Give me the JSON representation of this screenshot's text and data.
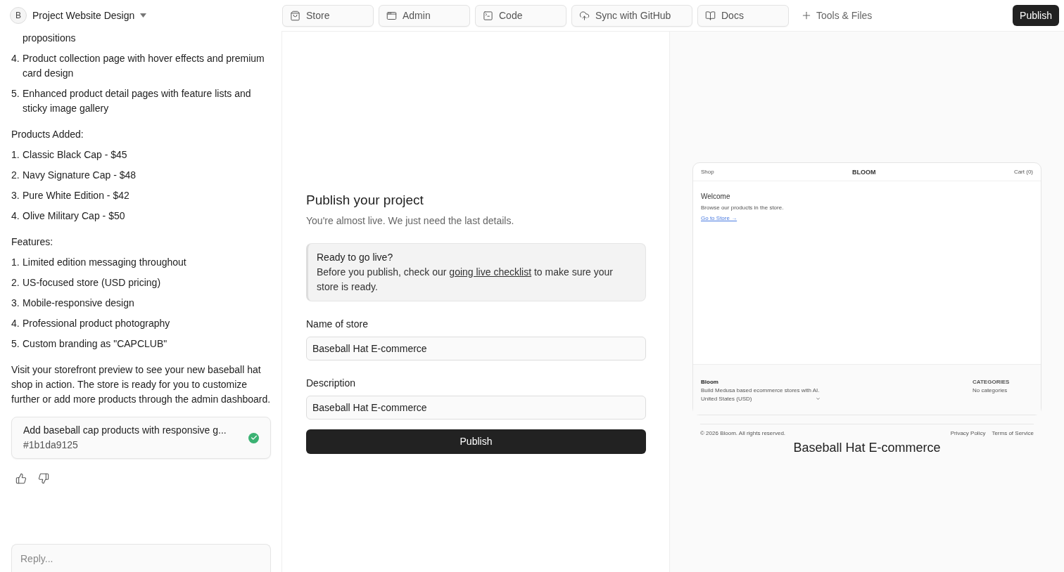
{
  "project": {
    "avatar": "B",
    "title": "Project Website Design"
  },
  "tabs": [
    {
      "label": "Store"
    },
    {
      "label": "Admin"
    },
    {
      "label": "Code"
    },
    {
      "label": "Sync with GitHub"
    },
    {
      "label": "Docs"
    }
  ],
  "tools": "Tools & Files",
  "publish_top": "Publish",
  "chat": [
    {
      "kind": "cont",
      "text": "propositions"
    },
    {
      "kind": "item",
      "num": "4.",
      "text": "Product collection page with hover effects and premium card design"
    },
    {
      "kind": "item",
      "num": "5.",
      "text": "Enhanced product detail pages with feature lists and sticky image gallery"
    },
    {
      "kind": "head",
      "text": "Products Added:"
    },
    {
      "kind": "item",
      "num": "1.",
      "text": "Classic Black Cap - $45"
    },
    {
      "kind": "item",
      "num": "2.",
      "text": "Navy Signature Cap - $48"
    },
    {
      "kind": "item",
      "num": "3.",
      "text": "Pure White Edition - $42"
    },
    {
      "kind": "item",
      "num": "4.",
      "text": "Olive Military Cap - $50"
    },
    {
      "kind": "head",
      "text": "Features:"
    },
    {
      "kind": "item",
      "num": "1.",
      "text": "Limited edition messaging throughout"
    },
    {
      "kind": "item",
      "num": "2.",
      "text": "US-focused store (USD pricing)"
    },
    {
      "kind": "item",
      "num": "3.",
      "text": "Mobile-responsive design"
    },
    {
      "kind": "item",
      "num": "4.",
      "text": "Professional product photography"
    },
    {
      "kind": "item",
      "num": "5.",
      "text": "Custom branding as \"CAPCLUB\""
    },
    {
      "kind": "para",
      "text": "Visit your storefront preview to see your new baseball hat shop in action. The store is ready for you to customize further or add more products through the admin dashboard."
    }
  ],
  "commit": {
    "title": "Add baseball cap products with responsive g...",
    "hash": "#1b1da9125",
    "done": true
  },
  "reply": {
    "placeholder": "Reply..."
  },
  "form": {
    "title": "Publish your project",
    "subtitle": "You're almost live. We just need the last details.",
    "notice": {
      "title": "Ready to go live?",
      "before": "Before you publish, check our ",
      "link": "going live checklist",
      "after": " to make sure your store is ready."
    },
    "fields": [
      {
        "label": "Name of store",
        "value": "Baseball Hat E-commerce"
      },
      {
        "label": "Description",
        "value": "Baseball Hat E-commerce"
      }
    ],
    "button": "Publish"
  },
  "preview": {
    "nav": [
      "Shop",
      "BLOOM",
      "Cart (0)"
    ],
    "heading": "Welcome",
    "text": "Browse our products in the store.",
    "link": "Go to Store →",
    "footer": {
      "brand": "Bloom",
      "tagline": "Build Medusa based ecommerce stores with AI.",
      "region": "United States (USD)",
      "cat_title": "CATEGORIES",
      "cat_text": "No categories"
    },
    "copyright": "© 2026 Bloom. All rights reserved.",
    "links": [
      "Privacy Policy",
      "Terms of Service"
    ],
    "store_name": "Baseball Hat E-commerce"
  }
}
